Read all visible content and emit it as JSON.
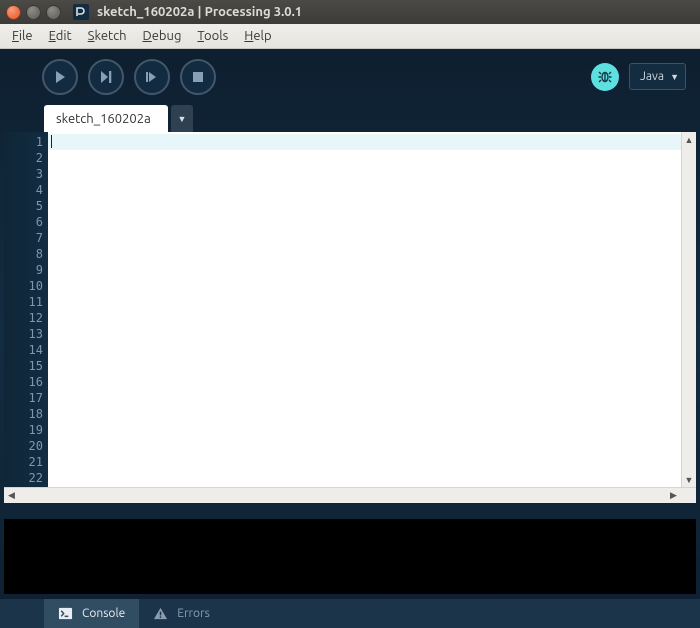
{
  "window": {
    "title": "sketch_160202a | Processing 3.0.1"
  },
  "menu": {
    "file": "File",
    "edit": "Edit",
    "sketch": "Sketch",
    "debug": "Debug",
    "tools": "Tools",
    "help": "Help"
  },
  "toolbar": {
    "mode_label": "Java"
  },
  "tabs": {
    "active": "sketch_160202a"
  },
  "editor": {
    "line_count": 22,
    "current_line": 1
  },
  "footer": {
    "console": "Console",
    "errors": "Errors"
  }
}
